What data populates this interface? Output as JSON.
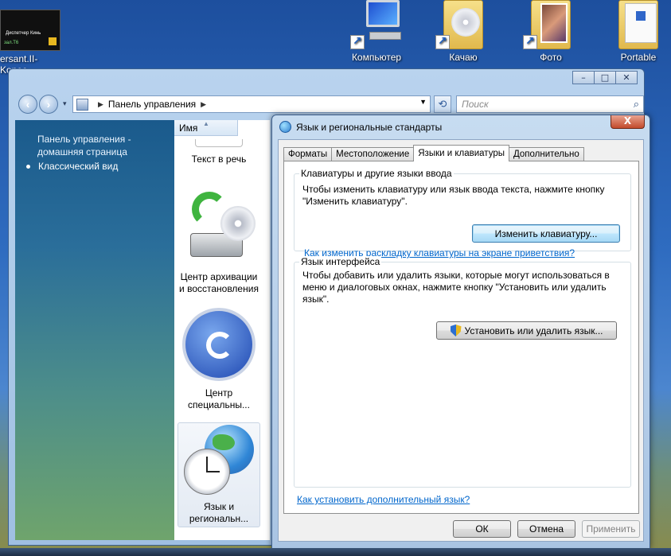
{
  "desktop": {
    "icons": [
      {
        "label": "ersant.II-Konec…",
        "icon": "video-thumbnail-icon"
      },
      {
        "label": "Компьютер",
        "icon": "computer-icon"
      },
      {
        "label": "Качаю",
        "icon": "folder-cd-icon"
      },
      {
        "label": "Фото",
        "icon": "folder-photos-icon"
      },
      {
        "label": "Portable",
        "icon": "folder-icon"
      }
    ],
    "thumbnail_caption": "Диспетчер Кинь",
    "thumbnail_subcaption": "зал.T6"
  },
  "explorer": {
    "address_path": "Панель управления",
    "search_placeholder": "Поиск",
    "sidebar": {
      "home_link": "Панель управления - домашняя страница",
      "classic_view": "Классический вид"
    },
    "column_header": "Имя",
    "items": [
      {
        "label": "Текст в речь",
        "icon": "text-to-speech-icon"
      },
      {
        "label": "Центр архивации и восстановления",
        "icon": "backup-restore-icon"
      },
      {
        "label": "Центр специальны...",
        "icon": "ease-of-access-icon"
      },
      {
        "label": "Язык и региональн...",
        "icon": "globe-clock-icon"
      }
    ]
  },
  "dialog": {
    "title": "Язык и региональные стандарты",
    "close_label": "X",
    "tabs": [
      "Форматы",
      "Местоположение",
      "Языки и клавиатуры",
      "Дополнительно"
    ],
    "active_tab": "Языки и клавиатуры",
    "keyboards_group": {
      "title": "Клавиатуры и другие языки ввода",
      "text": "Чтобы изменить клавиатуру или язык ввода текста, нажмите кнопку \"Изменить клавиатуру\".",
      "button": "Изменить клавиатуру...",
      "link": "Как изменить раскладку клавиатуры на экране приветствия?"
    },
    "display_language_group": {
      "title": "Язык интерфейса",
      "text": "Чтобы добавить или удалить языки, которые могут использоваться в меню и диалоговых окнах, нажмите кнопку \"Установить или удалить язык\".",
      "button": "Установить или удалить язык..."
    },
    "bottom_link": "Как установить дополнительный язык?",
    "ok": "ОК",
    "cancel": "Отмена",
    "apply": "Применить"
  }
}
